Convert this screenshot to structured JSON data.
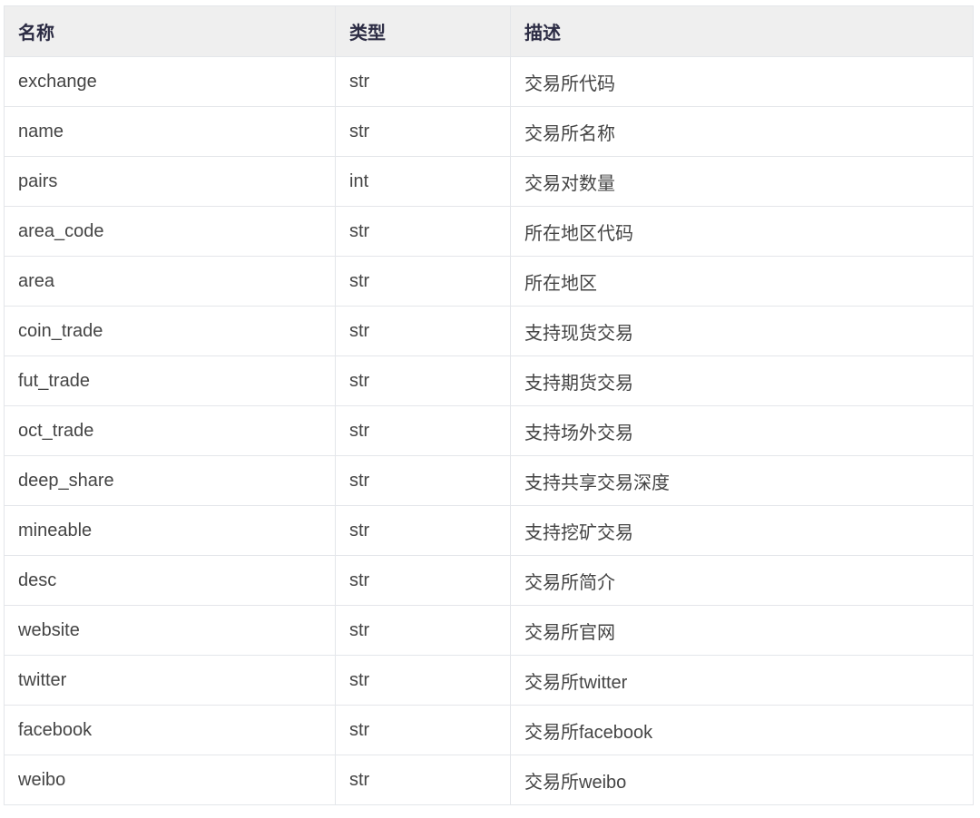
{
  "table": {
    "headers": [
      "名称",
      "类型",
      "描述"
    ],
    "rows": [
      [
        "exchange",
        "str",
        "交易所代码"
      ],
      [
        "name",
        "str",
        "交易所名称"
      ],
      [
        "pairs",
        "int",
        "交易对数量"
      ],
      [
        "area_code",
        "str",
        "所在地区代码"
      ],
      [
        "area",
        "str",
        "所在地区"
      ],
      [
        "coin_trade",
        "str",
        "支持现货交易"
      ],
      [
        "fut_trade",
        "str",
        "支持期货交易"
      ],
      [
        "oct_trade",
        "str",
        "支持场外交易"
      ],
      [
        "deep_share",
        "str",
        "支持共享交易深度"
      ],
      [
        "mineable",
        "str",
        "支持挖矿交易"
      ],
      [
        "desc",
        "str",
        "交易所简介"
      ],
      [
        "website",
        "str",
        "交易所官网"
      ],
      [
        "twitter",
        "str",
        "交易所twitter"
      ],
      [
        "facebook",
        "str",
        "交易所facebook"
      ],
      [
        "weibo",
        "str",
        "交易所weibo"
      ]
    ]
  }
}
